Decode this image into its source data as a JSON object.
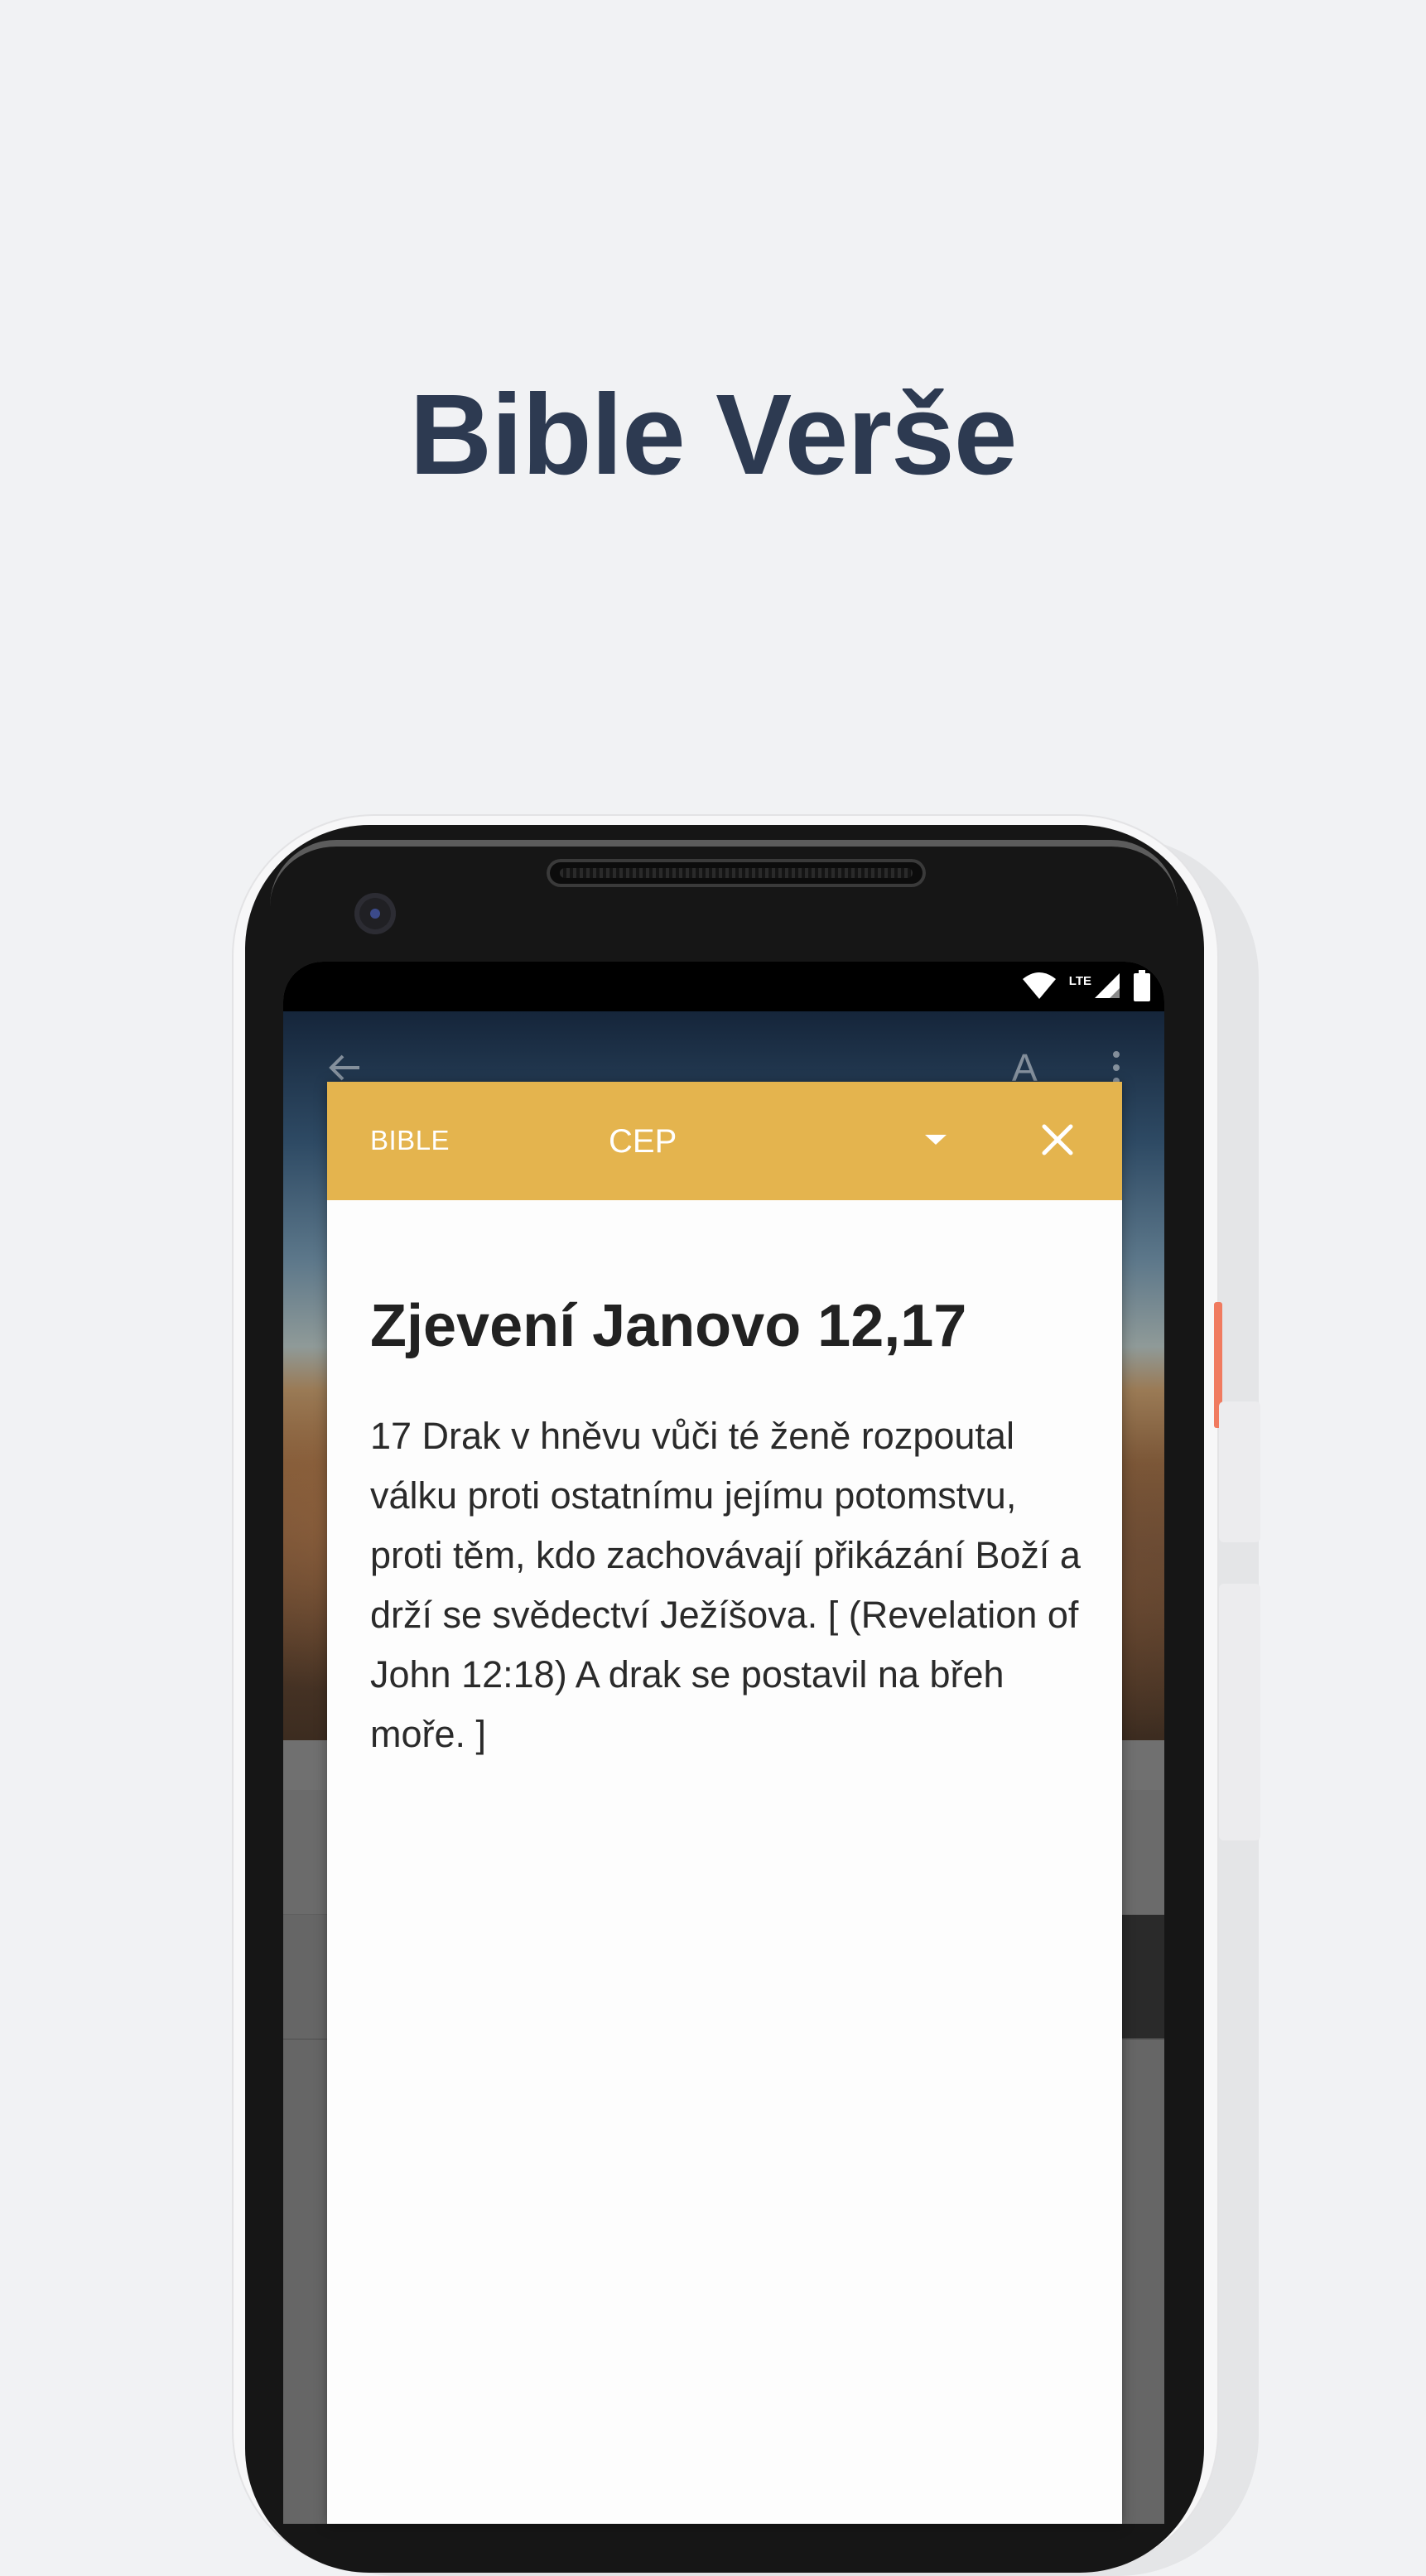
{
  "headline": "Bible Verše",
  "status_bar": {
    "network": "LTE"
  },
  "dialog": {
    "header": {
      "label": "BIBLE",
      "version": "CEP",
      "background": "#e4b44e"
    },
    "reference": "Zjevení Janovo 12,17",
    "text": "17 Drak v hněvu vůči té ženě rozpoutal válku proti ostatnímu jejímu potomstvu, proti těm, kdo zachovávají přikázání Boží a drží se svědectví Ježíšova. [ (Revelation of John 12:18) A drak se postavil na břeh moře. ]"
  },
  "colors": {
    "headline": "#2d3a51",
    "page_background": "#f1f2f4"
  },
  "icons": [
    "wifi-icon",
    "signal-icon",
    "battery-icon",
    "back-arrow-icon",
    "font-size-icon",
    "more-vert-icon",
    "dropdown-caret-icon",
    "close-icon"
  ]
}
